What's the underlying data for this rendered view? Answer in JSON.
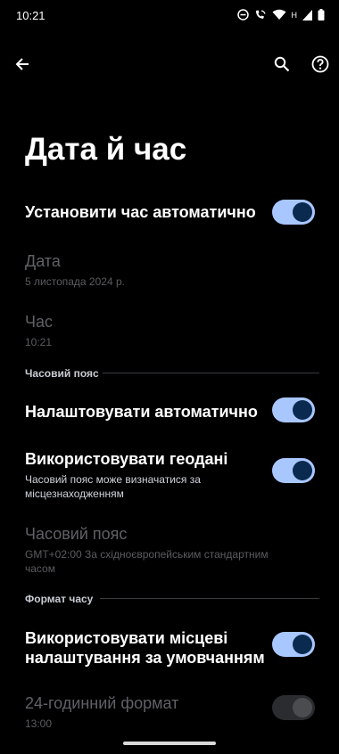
{
  "status_bar": {
    "time": "10:21",
    "network": "H"
  },
  "page": {
    "title": "Дата й час"
  },
  "settings": {
    "auto_time": {
      "label": "Установити час автоматично",
      "enabled": true
    },
    "date": {
      "label": "Дата",
      "value": "5 листопада 2024 р."
    },
    "time": {
      "label": "Час",
      "value": "10:21"
    },
    "timezone_section": {
      "header": "Часовий пояс"
    },
    "auto_timezone": {
      "label": "Налаштовувати автоматично",
      "enabled": true
    },
    "geo": {
      "label": "Використовувати геодані",
      "description": "Часовий пояс може визначатися за місцезнаходженням",
      "enabled": true
    },
    "timezone": {
      "label": "Часовий пояс",
      "value": "GMT+02:00 За східноєвропейським стандартним часом"
    },
    "format_section": {
      "header": "Формат часу"
    },
    "locale_default": {
      "label": "Використовувати місцеві налаштування за умовчанням",
      "enabled": true
    },
    "hour24": {
      "label": "24-годинний формат",
      "value": "13:00",
      "enabled": true
    }
  },
  "colors": {
    "toggle_on_track": "#a9c7ff",
    "toggle_on_knob": "#0b2a4f",
    "background": "#000000"
  }
}
